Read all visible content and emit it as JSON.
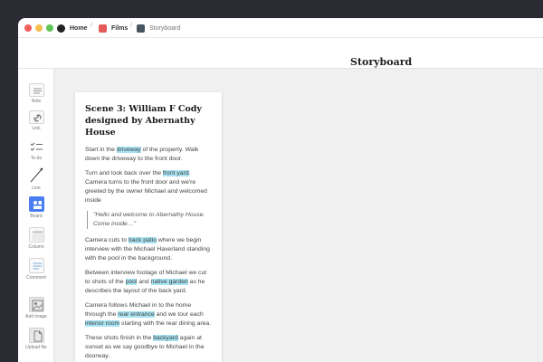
{
  "breadcrumb": {
    "home": "Home",
    "films": "Films",
    "storyboard": "Storyboard",
    "separator": "/"
  },
  "header": {
    "title": "Storyboard"
  },
  "toolbar": {
    "note": "Note",
    "link": "Link",
    "todo": "To-do",
    "line": "Line",
    "board": "Board",
    "column": "Column",
    "comment": "Comment",
    "add_image": "Add image",
    "upload_file": "Upload file"
  },
  "card": {
    "title": "Scene 3: William F Cody designed by Abernathy House",
    "p1_a": "Start in the ",
    "p1_h1": "driveway",
    "p1_b": " of the property. Walk down the driveway to the front door.",
    "p2_a": "Turn and look back over the ",
    "p2_h1": "front yard",
    "p2_b": ". Camera turns to the front door and we're greeted by the owner Michael and welcomed inside",
    "quote": "\"Hello and welcome to Abernathy House. Come inside…\"",
    "p3_a": "Camera cuts to ",
    "p3_h1": "back patio",
    "p3_b": " where we begin interview with the Michael Haverland standing with the pool in the background.",
    "p4_a": "Between interview footage of Michael we cut to shots of the ",
    "p4_h1": "pool",
    "p4_b": " and ",
    "p4_h2": "native garden",
    "p4_c": " as he describes the layout of the back yard.",
    "p5_a": "Camera follows Michael in to the home through the ",
    "p5_h1": "rear entrance",
    "p5_b": " and we tour each ",
    "p5_h2": "interior room",
    "p5_c": " starting with the rear dining area.",
    "p6_a": "These shots finish in the ",
    "p6_h1": "backyard",
    "p6_b": " again at sunset as we say goodbye to Michael in the doorway."
  },
  "colors": {
    "highlight": "#a7e3f2",
    "board_accent": "#4a7ef0",
    "films_icon": "#e45a5a",
    "storyboard_icon": "#475560"
  }
}
